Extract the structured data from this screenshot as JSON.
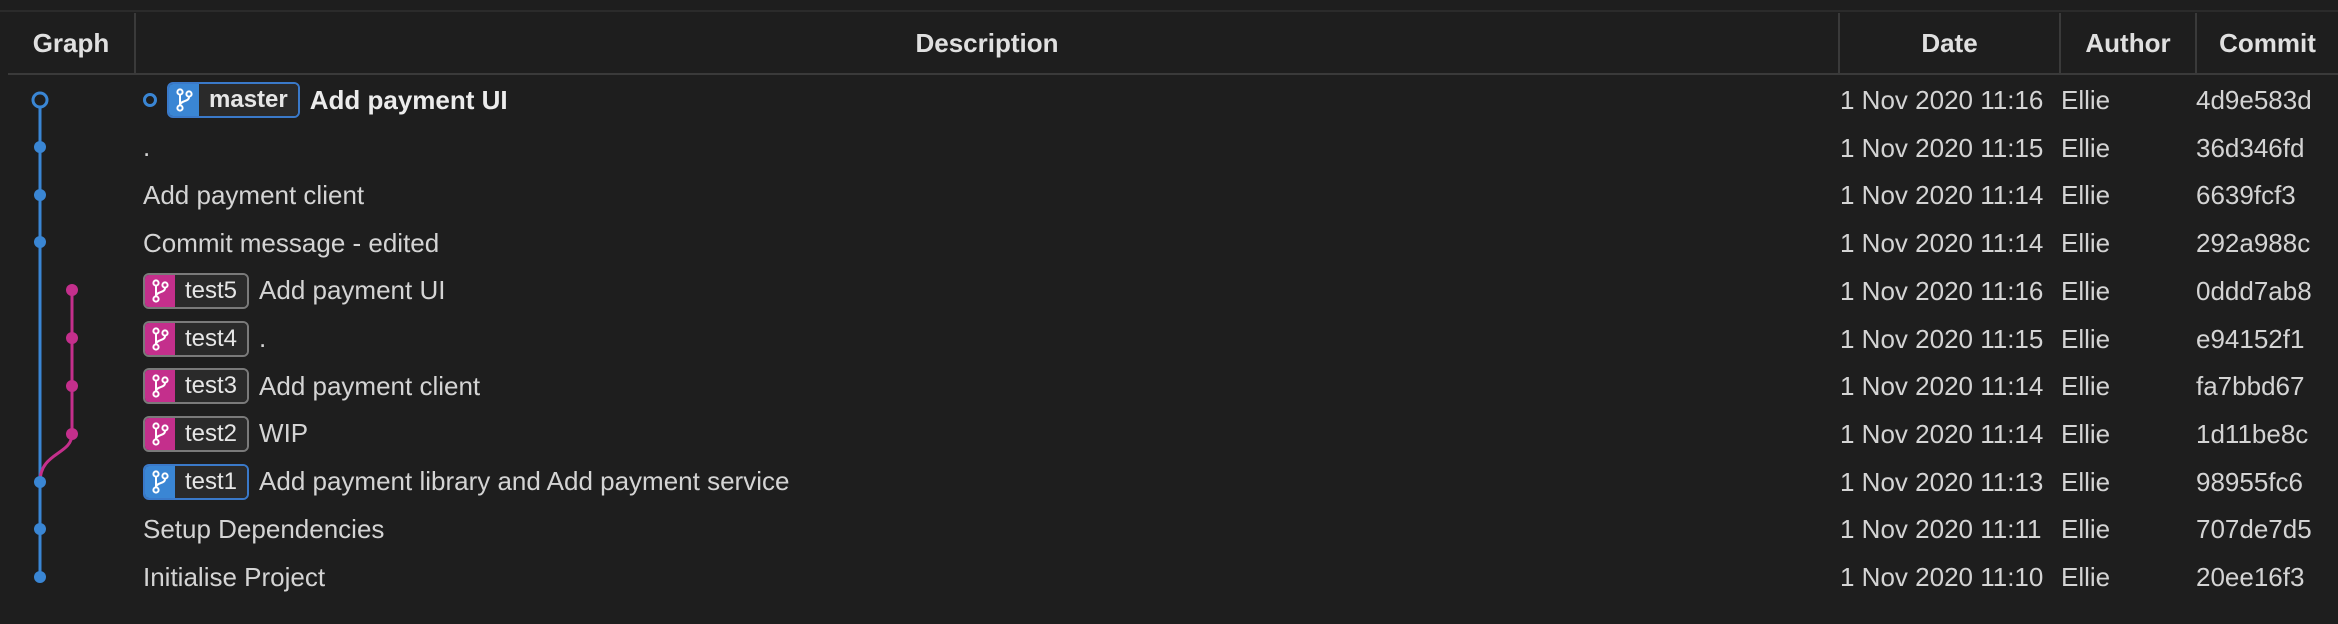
{
  "colors": {
    "background": "#1e1e1e",
    "branch_blue": "#3a86d4",
    "branch_pink": "#c42f8c",
    "text": "#d4d4d4"
  },
  "header": {
    "graph": "Graph",
    "description": "Description",
    "date": "Date",
    "author": "Author",
    "commit": "Commit"
  },
  "icons": {
    "branch": "git-branch-icon",
    "head": "circle-outline-icon"
  },
  "rows": [
    {
      "head": true,
      "branch": "master",
      "branch_color": "blue",
      "message": "Add payment UI",
      "date": "1 Nov 2020 11:16",
      "author": "Ellie",
      "commit": "4d9e583d"
    },
    {
      "message": ".",
      "date": "1 Nov 2020 11:15",
      "author": "Ellie",
      "commit": "36d346fd"
    },
    {
      "message": "Add payment client",
      "date": "1 Nov 2020 11:14",
      "author": "Ellie",
      "commit": "6639fcf3"
    },
    {
      "message": "Commit message - edited",
      "date": "1 Nov 2020 11:14",
      "author": "Ellie",
      "commit": "292a988c"
    },
    {
      "branch": "test5",
      "branch_color": "pink",
      "message": "Add payment UI",
      "date": "1 Nov 2020 11:16",
      "author": "Ellie",
      "commit": "0ddd7ab8"
    },
    {
      "branch": "test4",
      "branch_color": "pink",
      "message": ".",
      "date": "1 Nov 2020 11:15",
      "author": "Ellie",
      "commit": "e94152f1"
    },
    {
      "branch": "test3",
      "branch_color": "pink",
      "message": "Add payment client",
      "date": "1 Nov 2020 11:14",
      "author": "Ellie",
      "commit": "fa7bbd67"
    },
    {
      "branch": "test2",
      "branch_color": "pink",
      "message": "WIP",
      "date": "1 Nov 2020 11:14",
      "author": "Ellie",
      "commit": "1d11be8c"
    },
    {
      "branch": "test1",
      "branch_color": "blue",
      "message": "Add payment library and Add payment service",
      "date": "1 Nov 2020 11:13",
      "author": "Ellie",
      "commit": "98955fc6"
    },
    {
      "message": "Setup Dependencies",
      "date": "1 Nov 2020 11:11",
      "author": "Ellie",
      "commit": "707de7d5"
    },
    {
      "message": "Initialise Project",
      "date": "1 Nov 2020 11:10",
      "author": "Ellie",
      "commit": "20ee16f3"
    }
  ]
}
